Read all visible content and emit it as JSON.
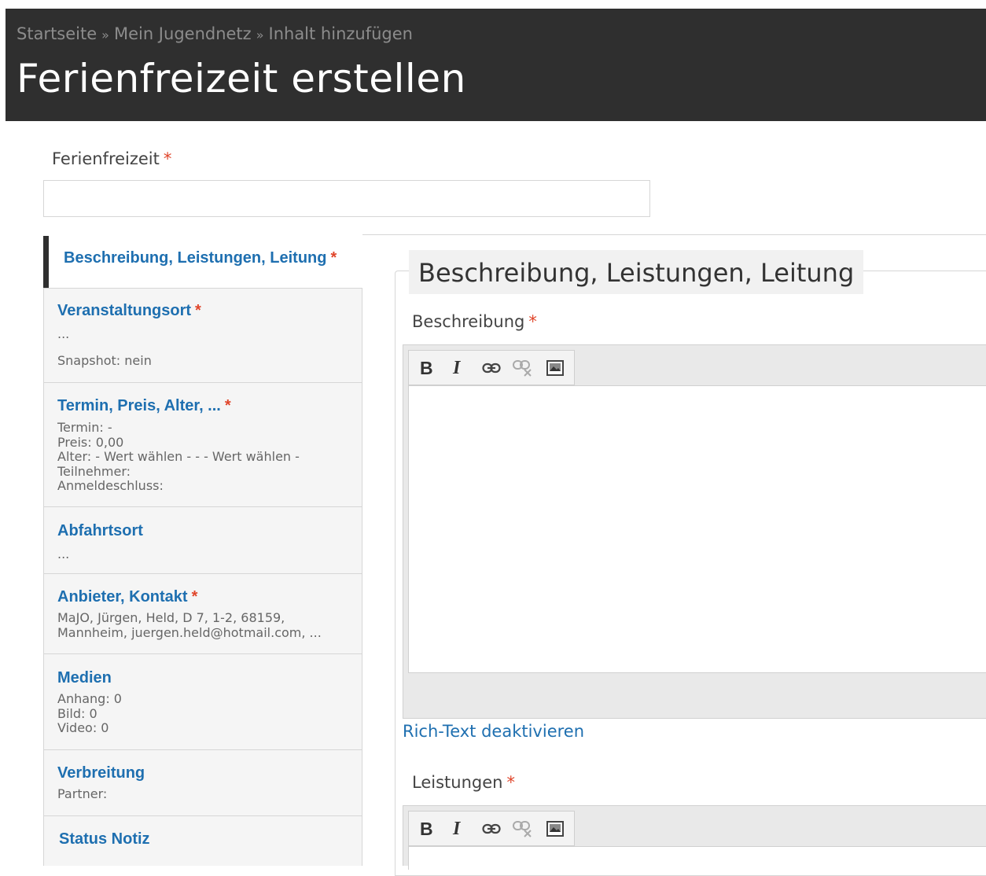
{
  "breadcrumb": {
    "items": [
      "Startseite",
      "Mein Jugendnetz",
      "Inhalt hinzufügen"
    ],
    "separator": "»"
  },
  "page_title": "Ferienfreizeit erstellen",
  "required_marker": "*",
  "title_field": {
    "label": "Ferienfreizeit",
    "value": ""
  },
  "tabs": [
    {
      "title": "Beschreibung, Leistungen, Leitung",
      "required": true,
      "active": true,
      "summary": []
    },
    {
      "title": "Veranstaltungsort",
      "required": true,
      "summary": [
        "...",
        "",
        "Snapshot: nein"
      ]
    },
    {
      "title": "Termin, Preis, Alter, ...",
      "required": true,
      "summary": [
        "Termin: -",
        "Preis: 0,00",
        "Alter: - Wert wählen - - - Wert wählen -",
        "Teilnehmer:",
        "Anmeldeschluss:"
      ]
    },
    {
      "title": "Abfahrtsort",
      "required": false,
      "summary": [
        "..."
      ]
    },
    {
      "title": "Anbieter, Kontakt",
      "required": true,
      "summary": [
        "MaJO, Jürgen, Held, D 7, 1-2, 68159,",
        "Mannheim, juergen.held@hotmail.com, ..."
      ]
    },
    {
      "title": "Medien",
      "required": false,
      "summary": [
        "Anhang: 0",
        "Bild: 0",
        "Video: 0"
      ]
    },
    {
      "title": "Verbreitung",
      "required": false,
      "summary": [
        "Partner:"
      ]
    },
    {
      "title": "Status Notiz",
      "required": false,
      "summary": []
    }
  ],
  "panel": {
    "legend": "Beschreibung, Leistungen, Leitung",
    "fields": [
      {
        "label": "Beschreibung",
        "required": true,
        "value": ""
      },
      {
        "label": "Leistungen",
        "required": true,
        "value": ""
      }
    ],
    "richtext_toggle": "Rich-Text deaktivieren"
  },
  "toolbar": {
    "bold": "B",
    "italic": "I",
    "icons": [
      "link-icon",
      "unlink-icon",
      "image-icon"
    ]
  },
  "colors": {
    "header_bg": "#2f2f2f",
    "link": "#1e6fb0",
    "required": "#e0452a",
    "tab_bg": "#f5f5f5"
  }
}
